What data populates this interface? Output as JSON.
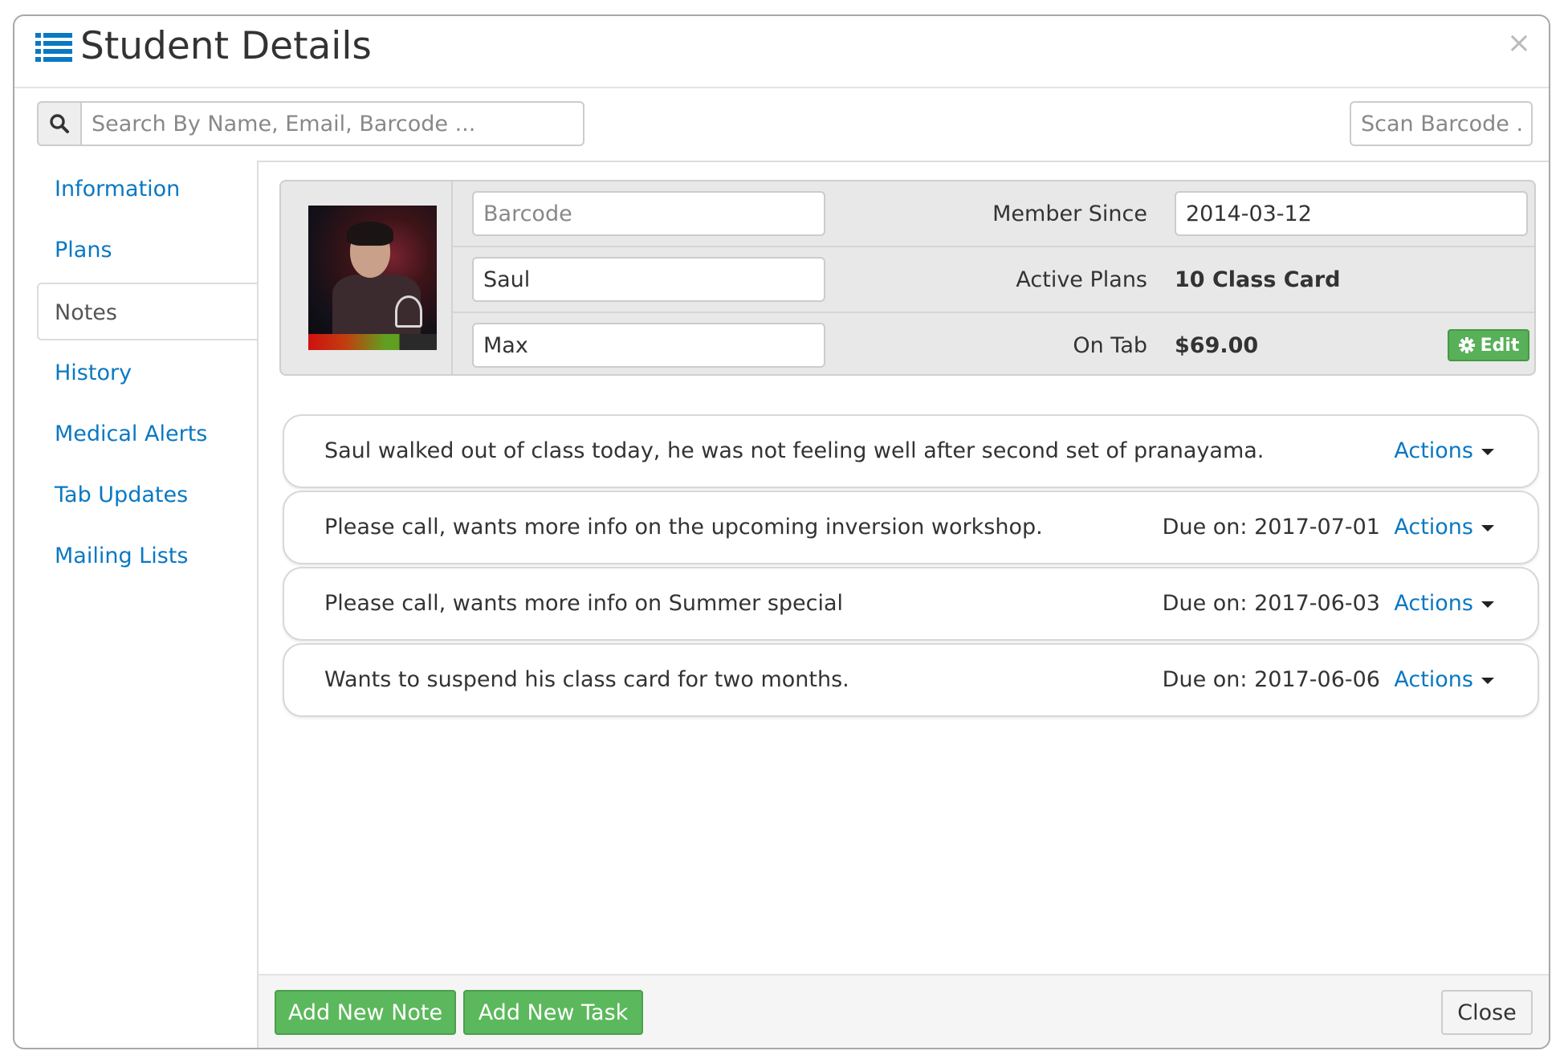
{
  "header": {
    "title": "Student Details",
    "close_label": "×"
  },
  "search": {
    "placeholder": "Search By Name, Email, Barcode ...",
    "scan_placeholder": "Scan Barcode ..."
  },
  "sidebar": {
    "items": [
      {
        "label": "Information"
      },
      {
        "label": "Plans"
      },
      {
        "label": "Notes"
      },
      {
        "label": "History"
      },
      {
        "label": "Medical Alerts"
      },
      {
        "label": "Tab Updates"
      },
      {
        "label": "Mailing Lists"
      }
    ],
    "active_index": 2
  },
  "profile": {
    "barcode_placeholder": "Barcode",
    "first_name": "Saul",
    "last_name": "Max",
    "member_since_label": "Member Since",
    "member_since_value": "2014-03-12",
    "active_plans_label": "Active Plans",
    "active_plans_value": "10 Class Card",
    "on_tab_label": "On Tab",
    "on_tab_value": "$69.00",
    "edit_label": "Edit"
  },
  "notes": [
    {
      "text": "Saul walked out of class today, he was not feeling well after second set of pranayama.",
      "due": "",
      "actions": "Actions"
    },
    {
      "text": "Please call, wants more info on the upcoming inversion workshop.",
      "due": "Due on: 2017-07-01",
      "actions": "Actions"
    },
    {
      "text": "Please call, wants more info on Summer special",
      "due": "Due on: 2017-06-03",
      "actions": "Actions"
    },
    {
      "text": "Wants to suspend his class card for two months.",
      "due": "Due on: 2017-06-06",
      "actions": "Actions"
    }
  ],
  "footer": {
    "add_note_label": "Add New Note",
    "add_task_label": "Add New Task",
    "close_label": "Close"
  },
  "colors": {
    "link": "#0a78c2",
    "success": "#5cb85c"
  }
}
